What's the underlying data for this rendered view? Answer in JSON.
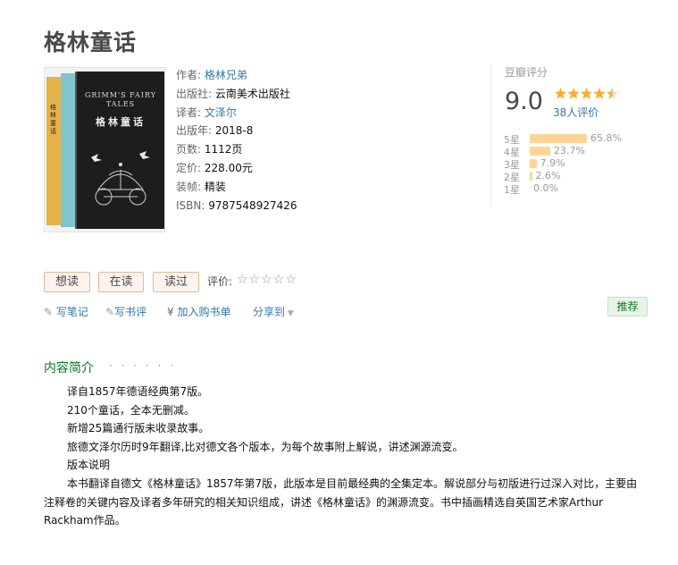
{
  "book": {
    "title": "格林童话",
    "cover": {
      "front_en": "GRIMM'S FAIRY TALES",
      "front_cn": "格林童话",
      "spine_cn": "格林童话"
    },
    "info": {
      "author_label": "作者:",
      "author": "格林兄弟",
      "publisher_label": "出版社:",
      "publisher": "云南美术出版社",
      "translator_label": "译者:",
      "translator": "文泽尔",
      "year_label": "出版年:",
      "year": "2018-8",
      "pages_label": "页数:",
      "pages": "1112页",
      "price_label": "定价:",
      "price": "228.00元",
      "binding_label": "装帧:",
      "binding": "精装",
      "isbn_label": "ISBN:",
      "isbn": "9787548927426"
    }
  },
  "rating": {
    "title": "豆瓣评分",
    "score": "9.0",
    "stars_value": 4.5,
    "count": "38人评价",
    "rows": [
      {
        "label": "5星",
        "percent": "65.8%",
        "value": 65.8
      },
      {
        "label": "4星",
        "percent": "23.7%",
        "value": 23.7
      },
      {
        "label": "3星",
        "percent": "7.9%",
        "value": 7.9
      },
      {
        "label": "2星",
        "percent": "2.6%",
        "value": 2.6
      },
      {
        "label": "1星",
        "percent": "0.0%",
        "value": 0.0
      }
    ],
    "bar_color": "#ffd596"
  },
  "actions": {
    "want": "想读",
    "reading": "在读",
    "read": "读过",
    "rate_label": "评价:",
    "empty_stars": "☆☆☆☆☆",
    "write_note": "写笔记",
    "write_review": "写书评",
    "add_cart": "加入购书单",
    "share": "分享到",
    "recommend": "推荐"
  },
  "intro": {
    "heading": "内容简介",
    "dots": "· · · · · ·",
    "paragraphs": [
      "译自1857年德语经典第7版。",
      "210个童话，全本无删减。",
      "新增25篇通行版未收录故事。",
      "旅德文泽尔历时9年翻译,比对德文各个版本，为每个故事附上解说，讲述渊源流变。",
      "版本说明",
      "本书翻译自德文《格林童话》1857年第7版，此版本是目前最经典的全集定本。解说部分与初版进行过深入对比，主要由注释卷的关键内容及译者多年研究的相关知识组成，讲述《格林童话》的渊源流变。书中插画精选自英国艺术家Arthur Rackham作品。"
    ]
  },
  "colors": {
    "link": "#3377aa",
    "heading_green": "#007722",
    "star": "#ffac2d"
  }
}
